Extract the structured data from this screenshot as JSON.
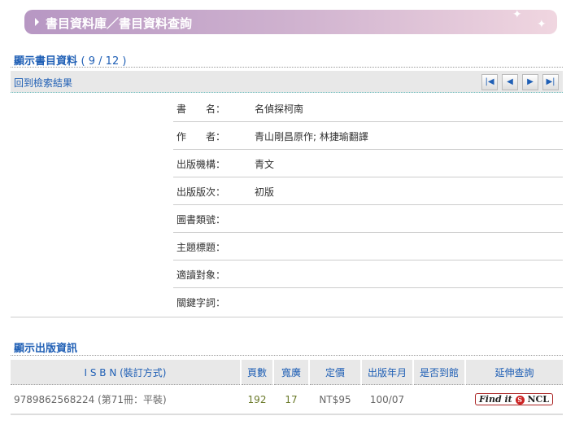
{
  "header": {
    "title": "書目資料庫／書目資料查詢"
  },
  "section1": {
    "title": "顯示書目資料",
    "count": "( 9 / 12 )",
    "back_link": "回到檢索結果",
    "nav": {
      "first": "⏮",
      "prev": "◀",
      "next": "▶",
      "last": "⏭"
    }
  },
  "fields": [
    {
      "label": "書　　名：",
      "value": "名偵探柯南"
    },
    {
      "label": "作　　者：",
      "value": "青山剛昌原作; 林捷瑜翻譯"
    },
    {
      "label": "出版機構：",
      "value": "青文"
    },
    {
      "label": "出版版次：",
      "value": "初版"
    },
    {
      "label": "圖書類號：",
      "value": ""
    },
    {
      "label": "主題標題：",
      "value": ""
    },
    {
      "label": "適讀對象：",
      "value": ""
    },
    {
      "label": "關鍵字詞：",
      "value": ""
    }
  ],
  "section2": {
    "title": "顯示出版資訊",
    "headers": [
      "I S B N (裝訂方式)",
      "頁數",
      "寬廣",
      "定價",
      "出版年月",
      "是否到館",
      "延伸查詢"
    ],
    "row": {
      "isbn": "9789862568224 (第71冊：平裝)",
      "pages": "192",
      "size": "17",
      "price": "NT$95",
      "date": "100/07",
      "arrived": "",
      "link_text": "Find it",
      "link_brand": "NCL",
      "link_logo": "S"
    }
  }
}
